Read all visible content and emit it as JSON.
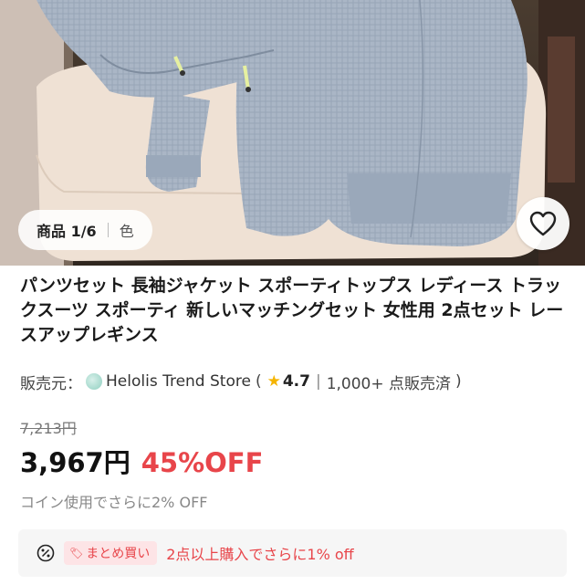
{
  "image": {
    "counter": "商品 1/6",
    "color_label": "色",
    "favorite_icon": "heart-outline-icon"
  },
  "product": {
    "title": "パンツセット 長袖ジャケット スポーティトップス レディース トラックスーツ スポーティ 新しいマッチングセット 女性用 2点セット レースアップレギンス"
  },
  "seller": {
    "label": "販売元：",
    "store_name": "Helolis Trend Store",
    "open_paren": "(",
    "rating": "4.7",
    "divider": "|",
    "sold": "1,000+ 点販売済",
    "close_paren": ")"
  },
  "price": {
    "original": "7,213円",
    "current": "3,967円",
    "discount": "45%OFF",
    "coin_note": "コイン使用でさらに2% OFF"
  },
  "promo": {
    "badge": "まとめ買い",
    "text": "2点以上購入でさらに1% off"
  },
  "colors": {
    "accent_red": "#e8454a",
    "star": "#f5b400",
    "text": "#1a1a1a"
  }
}
